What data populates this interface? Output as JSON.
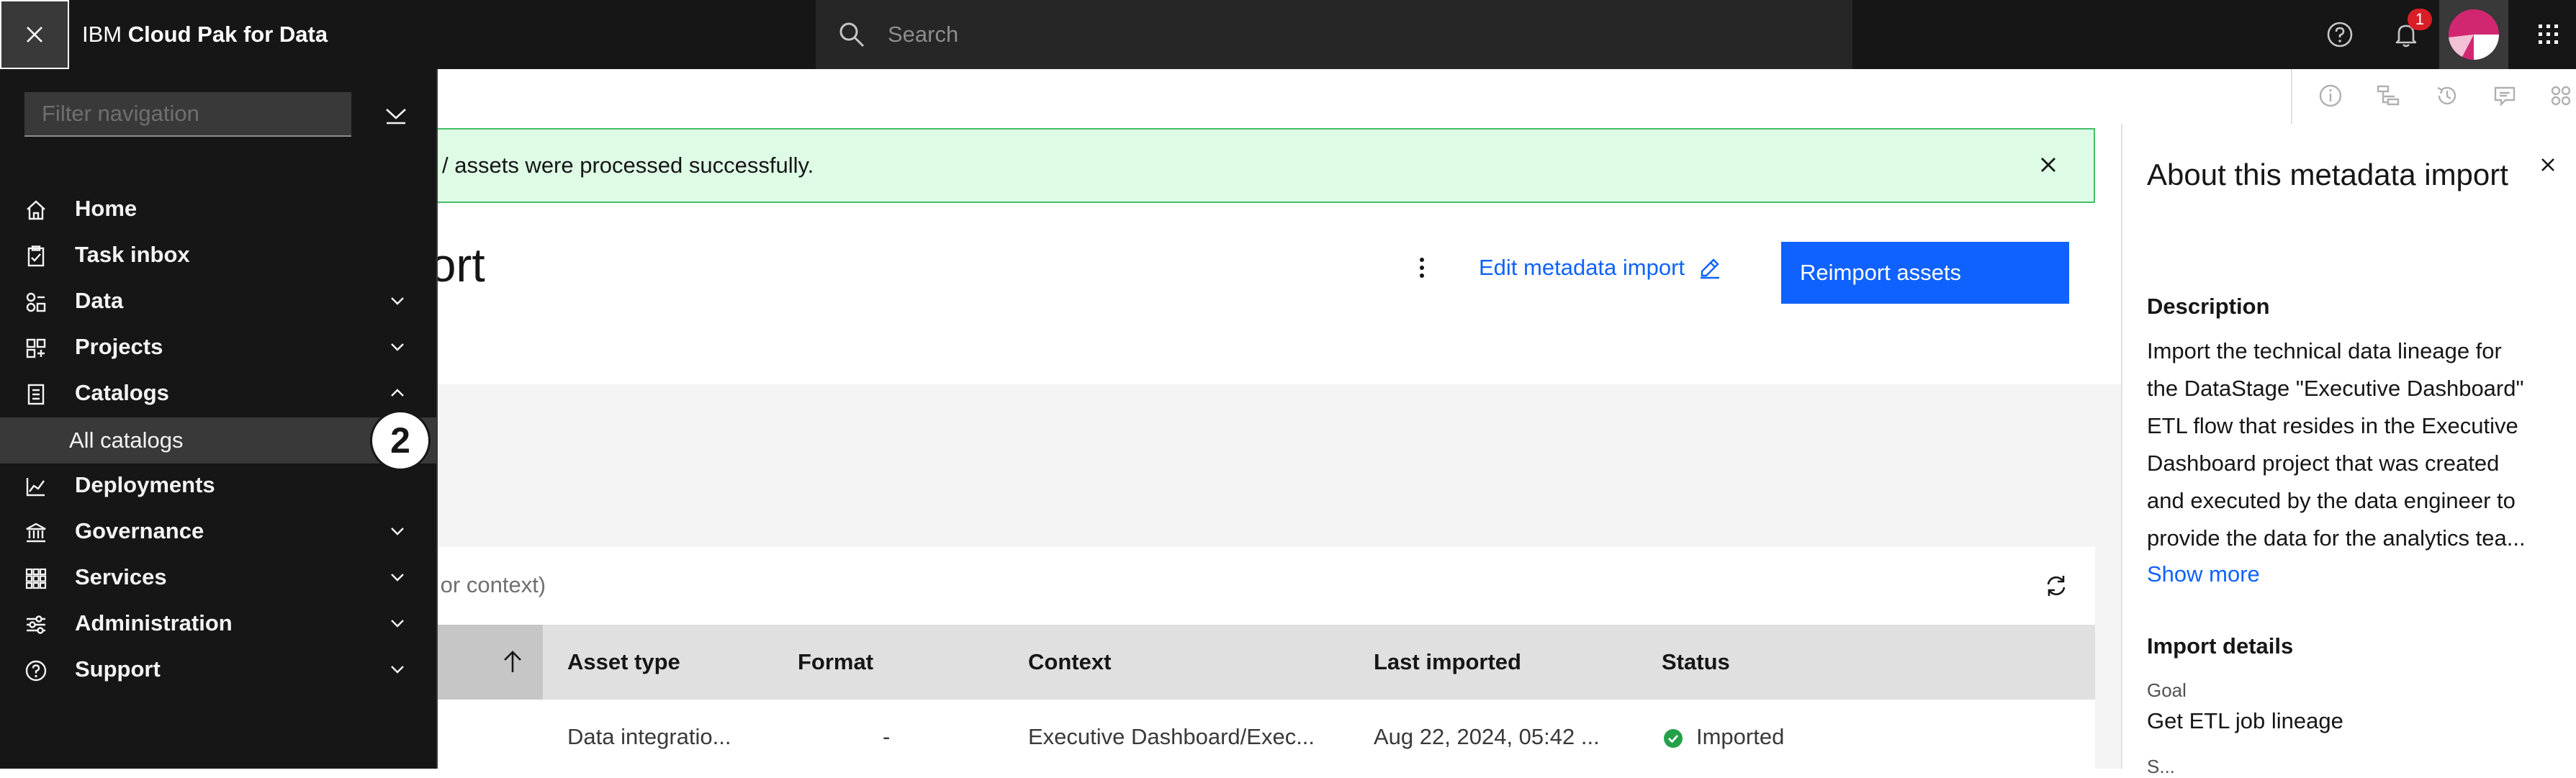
{
  "header": {
    "close_label": "×",
    "brand_prefix": "IBM",
    "brand_name": "Cloud Pak for Data",
    "search_placeholder": "Search",
    "notification_count": "1"
  },
  "leftnav": {
    "filter_placeholder": "Filter navigation",
    "items": [
      {
        "label": "Home",
        "icon": "home-icon",
        "expandable": false
      },
      {
        "label": "Task inbox",
        "icon": "clipboard-icon",
        "expandable": false
      },
      {
        "label": "Data",
        "icon": "data-icon",
        "expandable": true
      },
      {
        "label": "Projects",
        "icon": "projects-icon",
        "expandable": true
      },
      {
        "label": "Catalogs",
        "icon": "catalog-icon",
        "expandable": true,
        "expanded": true
      },
      {
        "label": "Deployments",
        "icon": "chart-line-icon",
        "expandable": false
      },
      {
        "label": "Governance",
        "icon": "bank-icon",
        "expandable": true
      },
      {
        "label": "Services",
        "icon": "grid-icon",
        "expandable": true
      },
      {
        "label": "Administration",
        "icon": "settings-adjust-icon",
        "expandable": true
      },
      {
        "label": "Support",
        "icon": "help-icon",
        "expandable": true
      }
    ],
    "sub_item": "All catalogs",
    "step_badge": "2"
  },
  "notification": {
    "text": "/ assets were processed successfully."
  },
  "page": {
    "title": "port",
    "edit_link": "Edit metadata import",
    "reimport_button": "Reimport assets",
    "filter_text": "me or context)"
  },
  "table": {
    "headers": [
      "Asset type",
      "Format",
      "Context",
      "Last imported",
      "Status"
    ],
    "row": {
      "asset_type": "Data integratio...",
      "format": "-",
      "context": "Executive Dashboard/Exec...",
      "last_imported": "Aug 22, 2024, 05:42 ...",
      "status": "Imported"
    }
  },
  "panel": {
    "title": "About this metadata import",
    "description_heading": "Description",
    "description_lines": [
      "Import the technical data lineage for",
      "the DataStage \"Executive Dashboard\"",
      "ETL flow that resides in the Executive",
      "Dashboard project that was created",
      "and executed by the data engineer to",
      "provide the data for the analytics tea..."
    ],
    "show_more": "Show more",
    "import_details_heading": "Import details",
    "goal_label": "Goal",
    "goal_value": "Get ETL job lineage",
    "next_label": "S..."
  },
  "colors": {
    "header_bg": "#161616",
    "primary": "#0f62fe",
    "success_bg": "#defbe6",
    "success": "#24a148",
    "badge": "#da1e28"
  }
}
